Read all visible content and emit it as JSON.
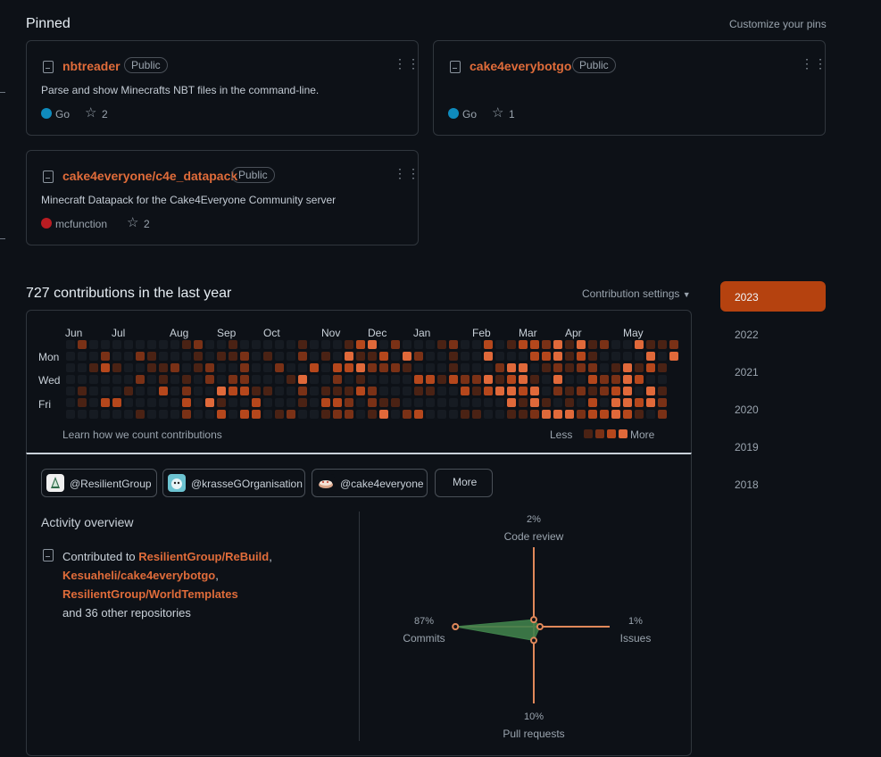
{
  "pinned": {
    "title": "Pinned",
    "customize": "Customize your pins",
    "repos": [
      {
        "name": "nbtreader",
        "visibility": "Public",
        "description": "Parse and show Minecrafts NBT files in the command-line.",
        "language": "Go",
        "language_color": "#0f8bbd",
        "stars": "2"
      },
      {
        "name": "cake4everybotgo",
        "visibility": "Public",
        "description": "",
        "language": "Go",
        "language_color": "#0f8bbd",
        "stars": "1"
      },
      {
        "name": "cake4everyone/c4e_datapack",
        "visibility": "Public",
        "description": "Minecraft Datapack for the Cake4Everyone Community server",
        "language": "mcfunction",
        "language_color": "#b91c22",
        "stars": "2"
      }
    ]
  },
  "contributions": {
    "title": "727 contributions in the last year",
    "settings": "Contribution settings",
    "months": [
      "Jun",
      "Jul",
      "Aug",
      "Sep",
      "Oct",
      "Nov",
      "Dec",
      "Jan",
      "Feb",
      "Mar",
      "Apr",
      "May"
    ],
    "days": [
      "Mon",
      "Wed",
      "Fri"
    ],
    "learn": "Learn how we count contributions",
    "less": "Less",
    "more": "More",
    "level_colors": [
      "#161b22",
      "#4a2214",
      "#7a3116",
      "#b5471c",
      "#e0693a"
    ]
  },
  "years": [
    "2023",
    "2022",
    "2021",
    "2020",
    "2019",
    "2018"
  ],
  "orgs": [
    {
      "label": "@ResilientGroup"
    },
    {
      "label": "@krasseGOrganisation"
    },
    {
      "label": "@cake4everyone"
    }
  ],
  "orgs_more": "More",
  "activity": {
    "title": "Activity overview",
    "contributed_to": "Contributed to",
    "repo1": "ResilientGroup/ReBuild",
    "repo2": "Kesuaheli/cake4everybotgo",
    "repo3": "ResilientGroup/WorldTemplates",
    "others": "and 36 other repositories",
    "comma": ","
  },
  "radar": {
    "code_review_pct": "2%",
    "code_review": "Code review",
    "issues_pct": "1%",
    "issues": "Issues",
    "pull_requests_pct": "10%",
    "pull_requests": "Pull requests",
    "commits_pct": "87%",
    "commits": "Commits",
    "values": {
      "commits": 87,
      "code_review": 2,
      "issues": 1,
      "pull_requests": 10
    },
    "line_color": "#e0885a",
    "fill_color": "#3f7f4a"
  }
}
